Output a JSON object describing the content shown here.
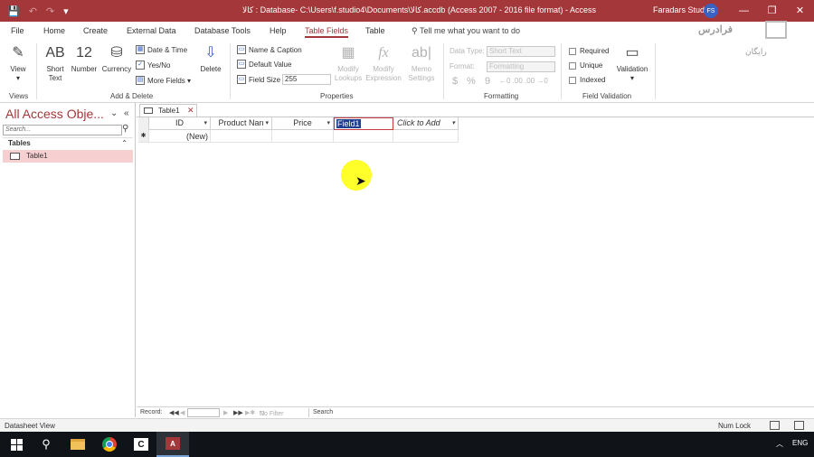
{
  "titlebar": {
    "title": "کالا : Database- C:\\Users\\f.studio4\\Documents\\کالا.accdb (Access 2007 - 2016 file format) - Access",
    "user": "Faradars Studio4",
    "avatar_initials": "FS",
    "save_icon": "💾",
    "undo_icon": "↶",
    "redo_icon": "↷",
    "customize_icon": "▾",
    "minimize": "—",
    "restore": "❐",
    "close": "✕"
  },
  "menu": {
    "tabs": [
      {
        "label": "File"
      },
      {
        "label": "Home"
      },
      {
        "label": "Create"
      },
      {
        "label": "External Data"
      },
      {
        "label": "Database Tools"
      },
      {
        "label": "Help"
      },
      {
        "label": "Table Fields"
      },
      {
        "label": "Table"
      }
    ],
    "tell_me": "Tell me what you want to do"
  },
  "ribbon": {
    "views": {
      "view_label": "View",
      "group": "Views"
    },
    "add_delete": {
      "short_text_icon": "AB",
      "short_text_label": "Short Text",
      "number_icon": "12",
      "number_label": "Number",
      "currency_label": "Currency",
      "date_time": "Date & Time",
      "yes_no": "Yes/No",
      "more_fields": "More Fields ▾",
      "delete_label": "Delete",
      "group": "Add & Delete"
    },
    "properties": {
      "name_caption": "Name & Caption",
      "default_value": "Default Value",
      "field_size_label": "Field Size",
      "field_size_value": "255",
      "modify_lookups": "Modify Lookups",
      "modify_expression": "Modify Expression",
      "memo_settings": "Memo Settings",
      "group": "Properties"
    },
    "formatting": {
      "data_type_label": "Data Type:",
      "data_type_value": "Short Text",
      "format_label": "Format:",
      "format_value": "Formatting",
      "currency_sym": "$",
      "percent_sym": "%",
      "comma_sym": "9",
      "inc_dec": "←0 .00",
      "dec_dec": ".00 →0",
      "group": "Formatting"
    },
    "validation": {
      "required": "Required",
      "unique": "Unique",
      "indexed": "Indexed",
      "validation_label": "Validation",
      "group": "Field Validation"
    }
  },
  "watermark": {
    "brand": "فرادرس",
    "tag": "رایگان"
  },
  "nav": {
    "header": "All Access Obje...",
    "search_placeholder": "Search...",
    "section": "Tables",
    "items": [
      {
        "label": "Table1"
      }
    ]
  },
  "document": {
    "tab_label": "Table1",
    "columns": [
      {
        "label": "ID"
      },
      {
        "label": "Product Nan"
      },
      {
        "label": "Price"
      },
      {
        "label": "Field1"
      },
      {
        "label": "Click to Add"
      }
    ],
    "new_row_marker": "✱",
    "new_row_value": "(New)"
  },
  "record_nav": {
    "record_label": "Record:",
    "first": "◀◀",
    "prev": "◀",
    "next": "▶",
    "last": "▶▶",
    "new": "▶✱",
    "filter": "No Filter",
    "search": "Search"
  },
  "status": {
    "left": "Datasheet View",
    "numlock": "Num Lock"
  },
  "taskbar": {
    "tray_lang": "ENG",
    "tray_chevron": "︿"
  }
}
